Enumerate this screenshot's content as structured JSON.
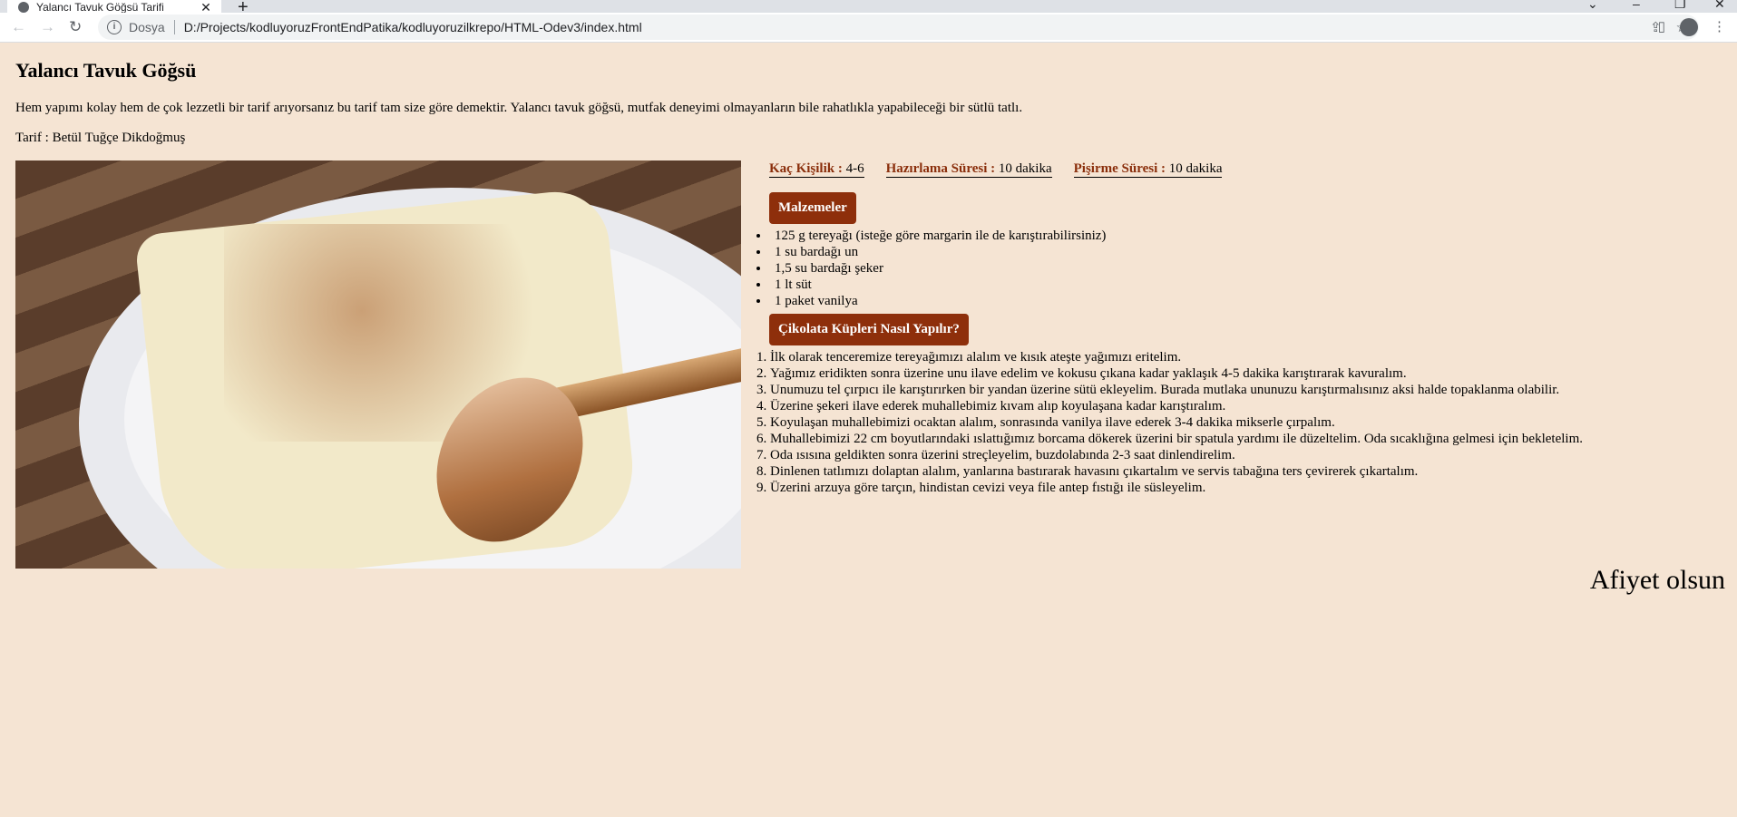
{
  "browser": {
    "tab_title": "Yalancı Tavuk Göğsü Tarifi",
    "omnibox_scheme": "Dosya",
    "url": "D:/Projects/kodluyoruzFrontEndPatika/kodluyoruzilkrepo/HTML-Odev3/index.html",
    "icons": [
      "back-icon",
      "forward-icon",
      "reload-icon",
      "info-icon",
      "share-icon",
      "star-icon",
      "side-panel-icon",
      "profile-icon",
      "menu-icon"
    ]
  },
  "recipe": {
    "title": "Yalancı Tavuk Göğsü",
    "intro": "Hem yapımı kolay hem de çok lezzetli bir tarif arıyorsanız bu tarif tam size göre demektir. Yalancı tavuk göğsü, mutfak deneyimi olmayanların bile rahatlıkla yapabileceği bir sütlü tatlı.",
    "author": "Tarif : Betül Tuğçe Dikdoğmuş",
    "meta": [
      {
        "label": "Kaç Kişilik :",
        "value": " 4-6"
      },
      {
        "label": "Hazırlama Süresi :",
        "value": " 10 dakika"
      },
      {
        "label": "Pişirme Süresi :",
        "value": " 10 dakika"
      }
    ],
    "ingredients_button": "Malzemeler",
    "ingredients": [
      "125 g tereyağı (isteğe göre margarin ile de karıştırabilirsiniz)",
      "1 su bardağı un",
      "1,5 su bardağı şeker",
      "1 lt süt",
      "1 paket vanilya"
    ],
    "steps_button": "Çikolata Küpleri Nasıl Yapılır?",
    "steps": [
      "İlk olarak tenceremize tereyağımızı alalım ve kısık ateşte yağımızı eritelim.",
      "Yağımız eridikten sonra üzerine unu ilave edelim ve kokusu çıkana kadar yaklaşık 4-5 dakika karıştırarak kavuralım.",
      "Unumuzu tel çırpıcı ile karıştırırken bir yandan üzerine sütü ekleyelim. Burada mutlaka ununuzu karıştırmalısınız aksi halde topaklanma olabilir.",
      "Üzerine şekeri ilave ederek muhallebimiz kıvam alıp koyulaşana kadar karıştıralım.",
      "Koyulaşan muhallebimizi ocaktan alalım, sonrasında vanilya ilave ederek 3-4 dakika mikserle çırpalım.",
      "Muhallebimizi 22 cm boyutlarındaki ıslattığımız borcama dökerek üzerini bir spatula yardımı ile düzeltelim. Oda sıcaklığına gelmesi için bekletelim.",
      "Oda ısısına geldikten sonra üzerini streçleyelim, buzdolabında 2-3 saat dinlendirelim.",
      "Dinlenen tatlımızı dolaptan alalım, yanlarına bastırarak havasını çıkartalım ve servis tabağına ters çevirerek çıkartalım.",
      "Üzerini arzuya göre tarçın, hindistan cevizi veya file antep fıstığı ile süsleyelim."
    ],
    "closing": "Afiyet olsun"
  },
  "colors": {
    "background": "#f5e4d3",
    "accent": "#8e2f0b"
  }
}
